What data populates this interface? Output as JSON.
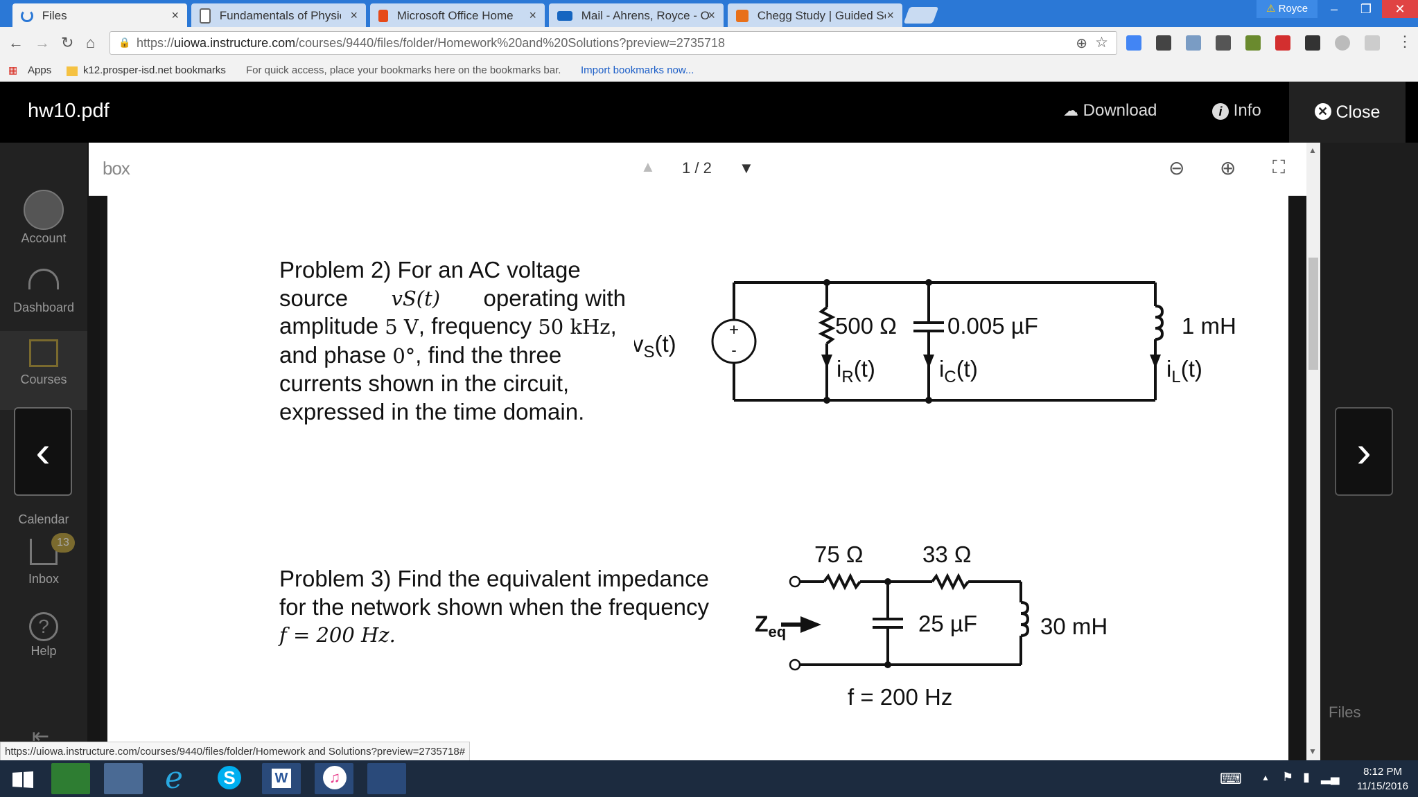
{
  "browser": {
    "tabs": [
      {
        "label": "Files",
        "active": true
      },
      {
        "label": "Fundamentals of Physics",
        "active": false
      },
      {
        "label": "Microsoft Office Home",
        "active": false
      },
      {
        "label": "Mail - Ahrens, Royce - O",
        "active": false
      },
      {
        "label": "Chegg Study | Guided So",
        "active": false
      }
    ],
    "tab_close_glyph": "×",
    "profile_name": "Royce",
    "url_scheme": "https://",
    "url_host": "uiowa.instructure.com",
    "url_path": "/courses/9440/files/folder/Homework%20and%20Solutions?preview=2735718",
    "bookmarks": {
      "apps_label": "Apps",
      "folder_label": "k12.prosper-isd.net bookmarks",
      "hint": "For quick access, place your bookmarks here on the bookmarks bar.",
      "import_link": "Import bookmarks now..."
    },
    "status_url": "https://uiowa.instructure.com/courses/9440/files/folder/Homework and Solutions?preview=2735718#"
  },
  "sidebar": {
    "items": [
      {
        "label": "Account"
      },
      {
        "label": "Dashboard"
      },
      {
        "label": "Courses"
      },
      {
        "label": "Calendar"
      },
      {
        "label": "Inbox",
        "badge": "13"
      },
      {
        "label": "Help"
      }
    ]
  },
  "viewer": {
    "file_title": "hw10.pdf",
    "download_label": "Download",
    "info_label": "Info",
    "close_label": "Close",
    "box_logo": "box",
    "page_indicator": "1 / 2",
    "files_link": "Files"
  },
  "document": {
    "problem2_text": {
      "l1": "Problem 2) For an AC voltage",
      "l2a": "source",
      "l2m": "vS(t)",
      "l2b": "operating with",
      "l3a": "amplitude",
      "l3m1": "5 V",
      "l3b": ", frequency",
      "l3m2": "50 kHz",
      "l3c": ",",
      "l4a": "and phase",
      "l4m": "0°",
      "l4b": ", find the three",
      "l5": "currents shown in the circuit,",
      "l6": "expressed in the time domain."
    },
    "problem3_text": {
      "l1": "Problem 3) Find the equivalent impedance",
      "l2": "for the network shown when the frequency",
      "l3": "f = 200 Hz."
    },
    "circuit1": {
      "source_label": "vS(t)",
      "v_main": "v",
      "v_sub": "S",
      "v_tail": "(t)",
      "plus": "+",
      "minus": "-",
      "resistor": "500 Ω",
      "capacitor": "0.005 µF",
      "inductor": "1 mH",
      "iR_main": "i",
      "iR_sub": "R",
      "iR_tail": "(t)",
      "iC_main": "i",
      "iC_sub": "C",
      "iC_tail": "(t)",
      "iL_main": "i",
      "iL_sub": "L",
      "iL_tail": "(t)"
    },
    "circuit2": {
      "r1": "75 Ω",
      "r2": "33 Ω",
      "capacitor": "25 µF",
      "inductor": "30 mH",
      "zeq_main": "Z",
      "zeq_sub": "eq",
      "freq": "f = 200 Hz"
    }
  },
  "taskbar": {
    "time": "8:12 PM",
    "date": "11/15/2016"
  }
}
